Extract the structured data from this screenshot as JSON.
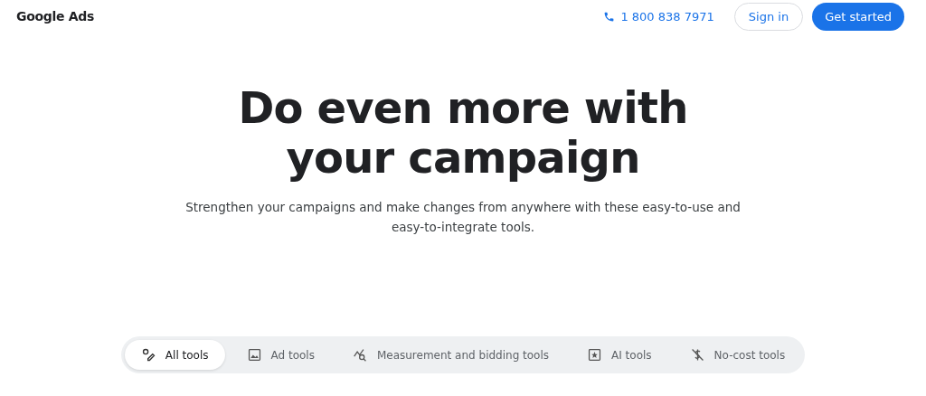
{
  "header": {
    "logo": "Google Ads",
    "phone": "1 800 838 7971",
    "sign_in": "Sign in",
    "get_started": "Get started"
  },
  "hero": {
    "title": "Do even more with your campaign",
    "subtitle": "Strengthen your campaigns and make changes from anywhere with these easy-to-use and easy-to-integrate tools."
  },
  "tabs": [
    {
      "label": "All tools",
      "kind": "all",
      "selected": true
    },
    {
      "label": "Ad tools",
      "kind": "ad",
      "selected": false
    },
    {
      "label": "Measurement and bidding tools",
      "kind": "measure",
      "selected": false
    },
    {
      "label": "AI tools",
      "kind": "ai",
      "selected": false
    },
    {
      "label": "No-cost tools",
      "kind": "free",
      "selected": false
    }
  ]
}
